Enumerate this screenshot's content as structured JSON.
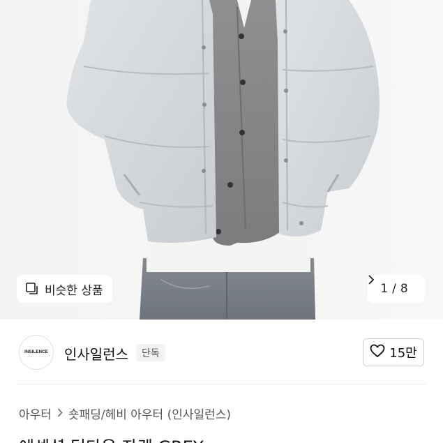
{
  "gallery": {
    "similar_label": "비슷한 상품",
    "pager": {
      "current": "1",
      "separator": "/",
      "total": "8"
    }
  },
  "shop": {
    "logo_text": "INSILENCE",
    "name": "인사일런스",
    "badge": "단독",
    "like_count": "15만"
  },
  "breadcrumb": {
    "items": [
      "아우터",
      "숏패딩/헤비 아우터 (인사일런스)"
    ]
  },
  "product": {
    "title": "에센셜 덕다운 자켓 GREY"
  },
  "colors": {
    "jacket": "#d6d9dc",
    "cardigan": "#8a8a8c",
    "jeans": "#737a82",
    "badge_bg": "#f1f2f4"
  }
}
